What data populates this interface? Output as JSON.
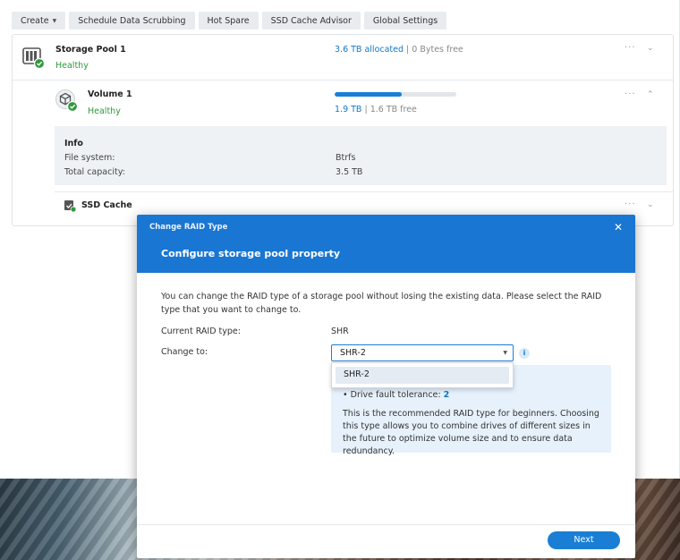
{
  "toolbar": {
    "create": "Create",
    "schedule": "Schedule Data Scrubbing",
    "hot_spare": "Hot Spare",
    "ssd_advisor": "SSD Cache Advisor",
    "global_settings": "Global Settings"
  },
  "pool": {
    "name": "Storage Pool 1",
    "status": "Healthy",
    "allocated": "3.6 TB allocated",
    "separator": " | ",
    "free": "0 Bytes free",
    "more": "···"
  },
  "volume": {
    "name": "Volume 1",
    "status": "Healthy",
    "used": "1.9 TB",
    "separator": " | ",
    "free": "1.6 TB free",
    "usage_fraction": 0.55,
    "more": "···"
  },
  "info": {
    "title": "Info",
    "filesystem_label": "File system:",
    "filesystem_value": "Btrfs",
    "capacity_label": "Total capacity:",
    "capacity_value": "3.5 TB"
  },
  "ssd_cache": {
    "name": "SSD Cache",
    "more": "···"
  },
  "modal": {
    "window_title": "Change RAID Type",
    "heading": "Configure storage pool property",
    "description": "You can change the RAID type of a storage pool without losing the existing data. Please select the RAID type that you want to change to.",
    "current_label": "Current RAID type:",
    "current_value": "SHR",
    "change_label": "Change to:",
    "select_value": "SHR-2",
    "dropdown_option": "SHR-2",
    "tolerance_label": "Drive fault tolerance: ",
    "tolerance_value": "2",
    "recommendation": "This is the recommended RAID type for beginners. Choosing this type allows you to combine drives of different sizes in the future to optimize volume size and to ensure data redundancy.",
    "next": "Next"
  },
  "colors": {
    "accent": "#1a7fd4",
    "healthy": "#2e9a3c",
    "header": "#1976d2"
  }
}
